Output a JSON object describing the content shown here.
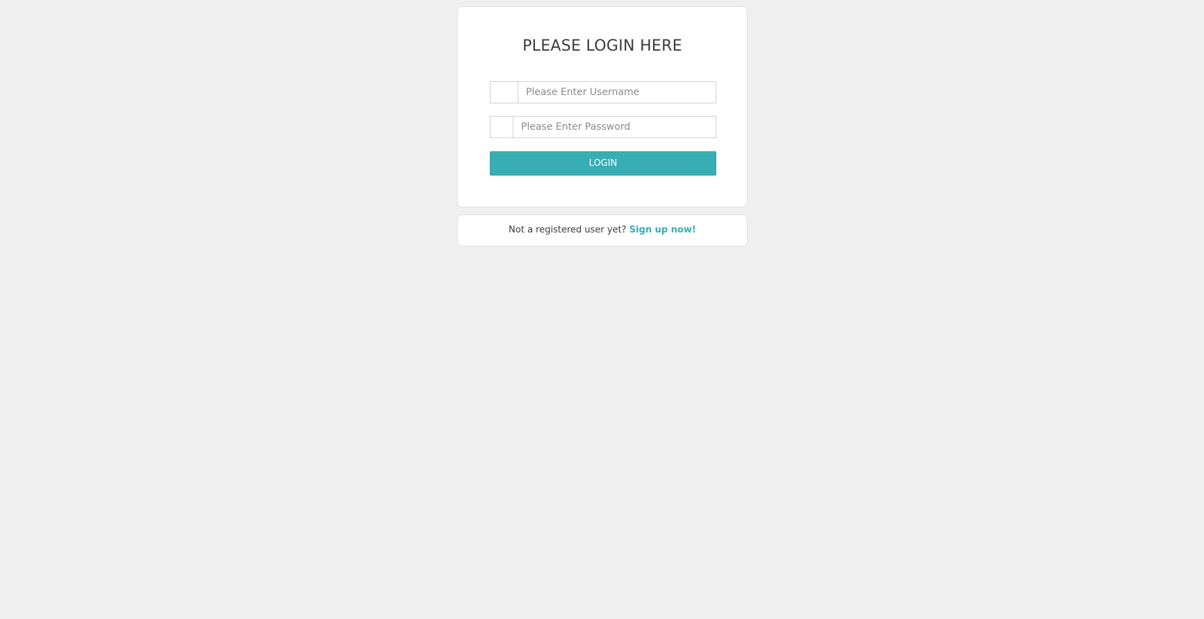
{
  "login": {
    "title": "PLEASE LOGIN HERE",
    "username_placeholder": "Please Enter Username",
    "username_value": "",
    "password_placeholder": "Please Enter Password",
    "password_value": "",
    "button_label": "LOGIN"
  },
  "signup": {
    "prompt": "Not a registered user yet? ",
    "link_label": "Sign up now!"
  },
  "colors": {
    "page_background": "#efefef",
    "card_background": "#ffffff",
    "accent": "#38adb3",
    "text": "#3a3a3a",
    "placeholder": "#8a8a8a"
  },
  "icons": {
    "username_addon": "user-icon",
    "password_addon": "lock-icon"
  }
}
